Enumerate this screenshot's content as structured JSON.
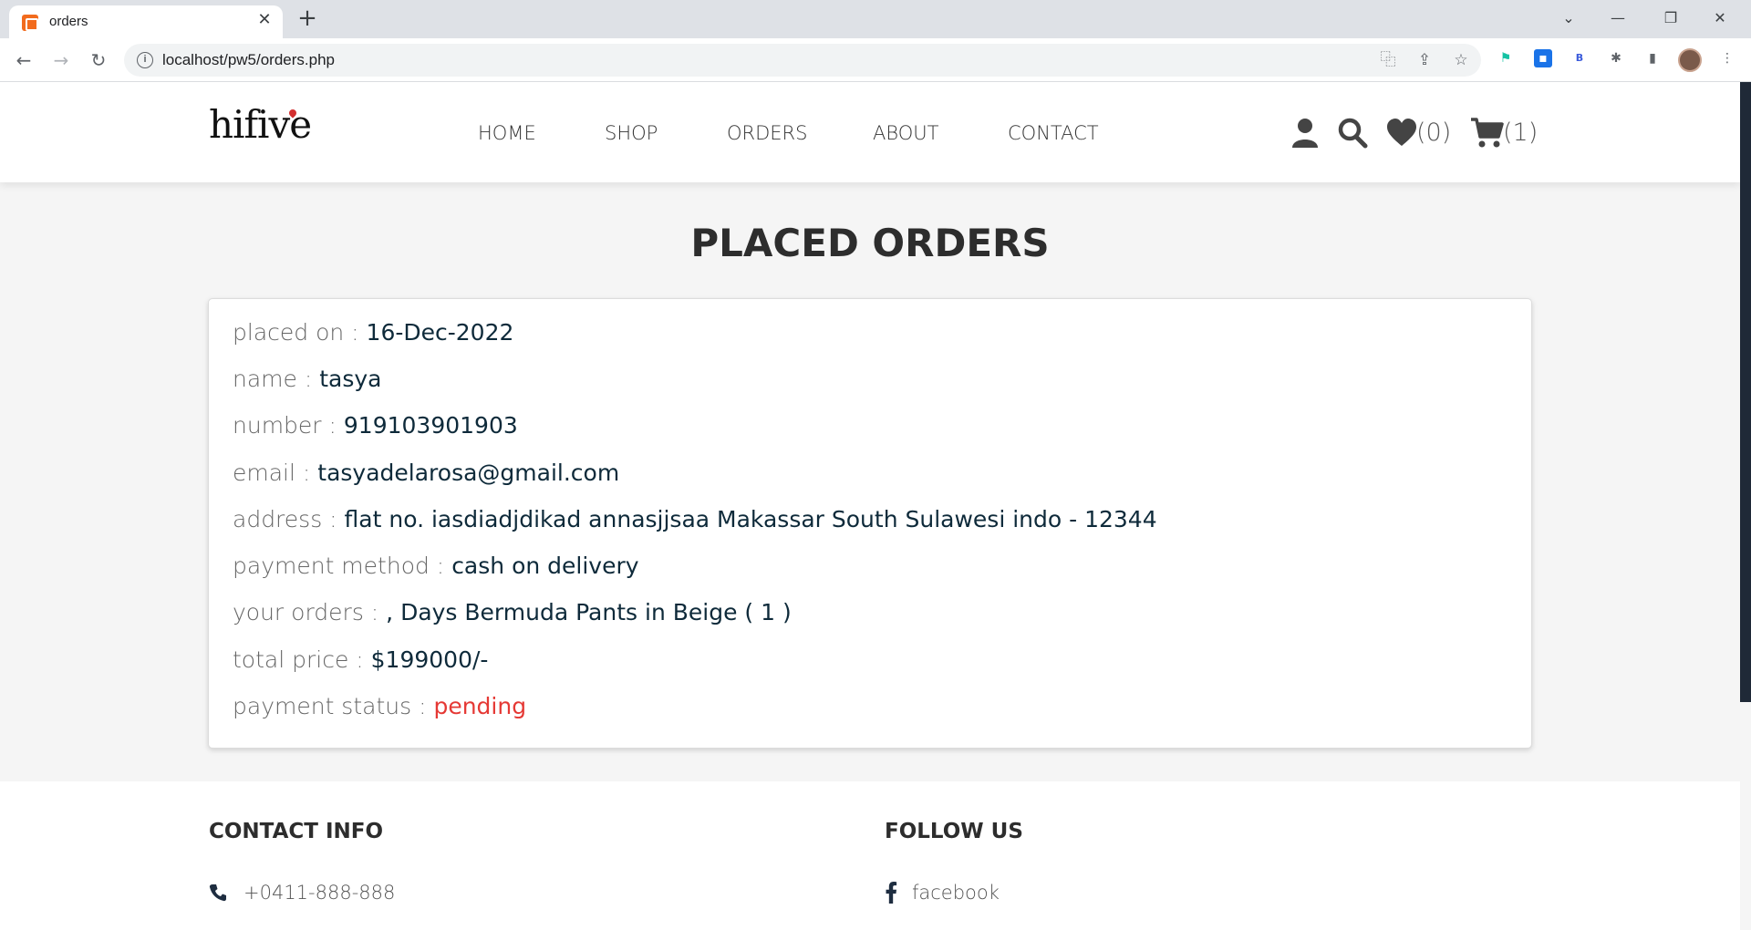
{
  "browser": {
    "tab_title": "orders",
    "url": "localhost/pw5/orders.php"
  },
  "site": {
    "logo": "hifive",
    "nav": [
      "HOME",
      "SHOP",
      "ORDERS",
      "ABOUT",
      "CONTACT"
    ],
    "wishlist_count": "(0)",
    "cart_count": "(1)"
  },
  "page": {
    "title": "PLACED ORDERS"
  },
  "order": {
    "fields": [
      {
        "label": "placed on : ",
        "value": "16-Dec-2022"
      },
      {
        "label": "name : ",
        "value": "tasya"
      },
      {
        "label": "number : ",
        "value": "919103901903"
      },
      {
        "label": "email : ",
        "value": "tasyadelarosa@gmail.com"
      },
      {
        "label": "address : ",
        "value": "flat no. iasdiadjdikad annasjjsaa Makassar South Sulawesi indo - 12344"
      },
      {
        "label": "payment method : ",
        "value": "cash on delivery"
      },
      {
        "label": "your orders : ",
        "value": ", Days Bermuda Pants in Beige ( 1 )"
      },
      {
        "label": "total price : ",
        "value": "$199000/-"
      },
      {
        "label": "payment status : ",
        "value": "pending"
      }
    ],
    "status_color": "#e53935"
  },
  "footer": {
    "contact_heading": "CONTACT INFO",
    "phone": "+0411-888-888",
    "follow_heading": "FOLLOW US",
    "facebook": "facebook"
  }
}
